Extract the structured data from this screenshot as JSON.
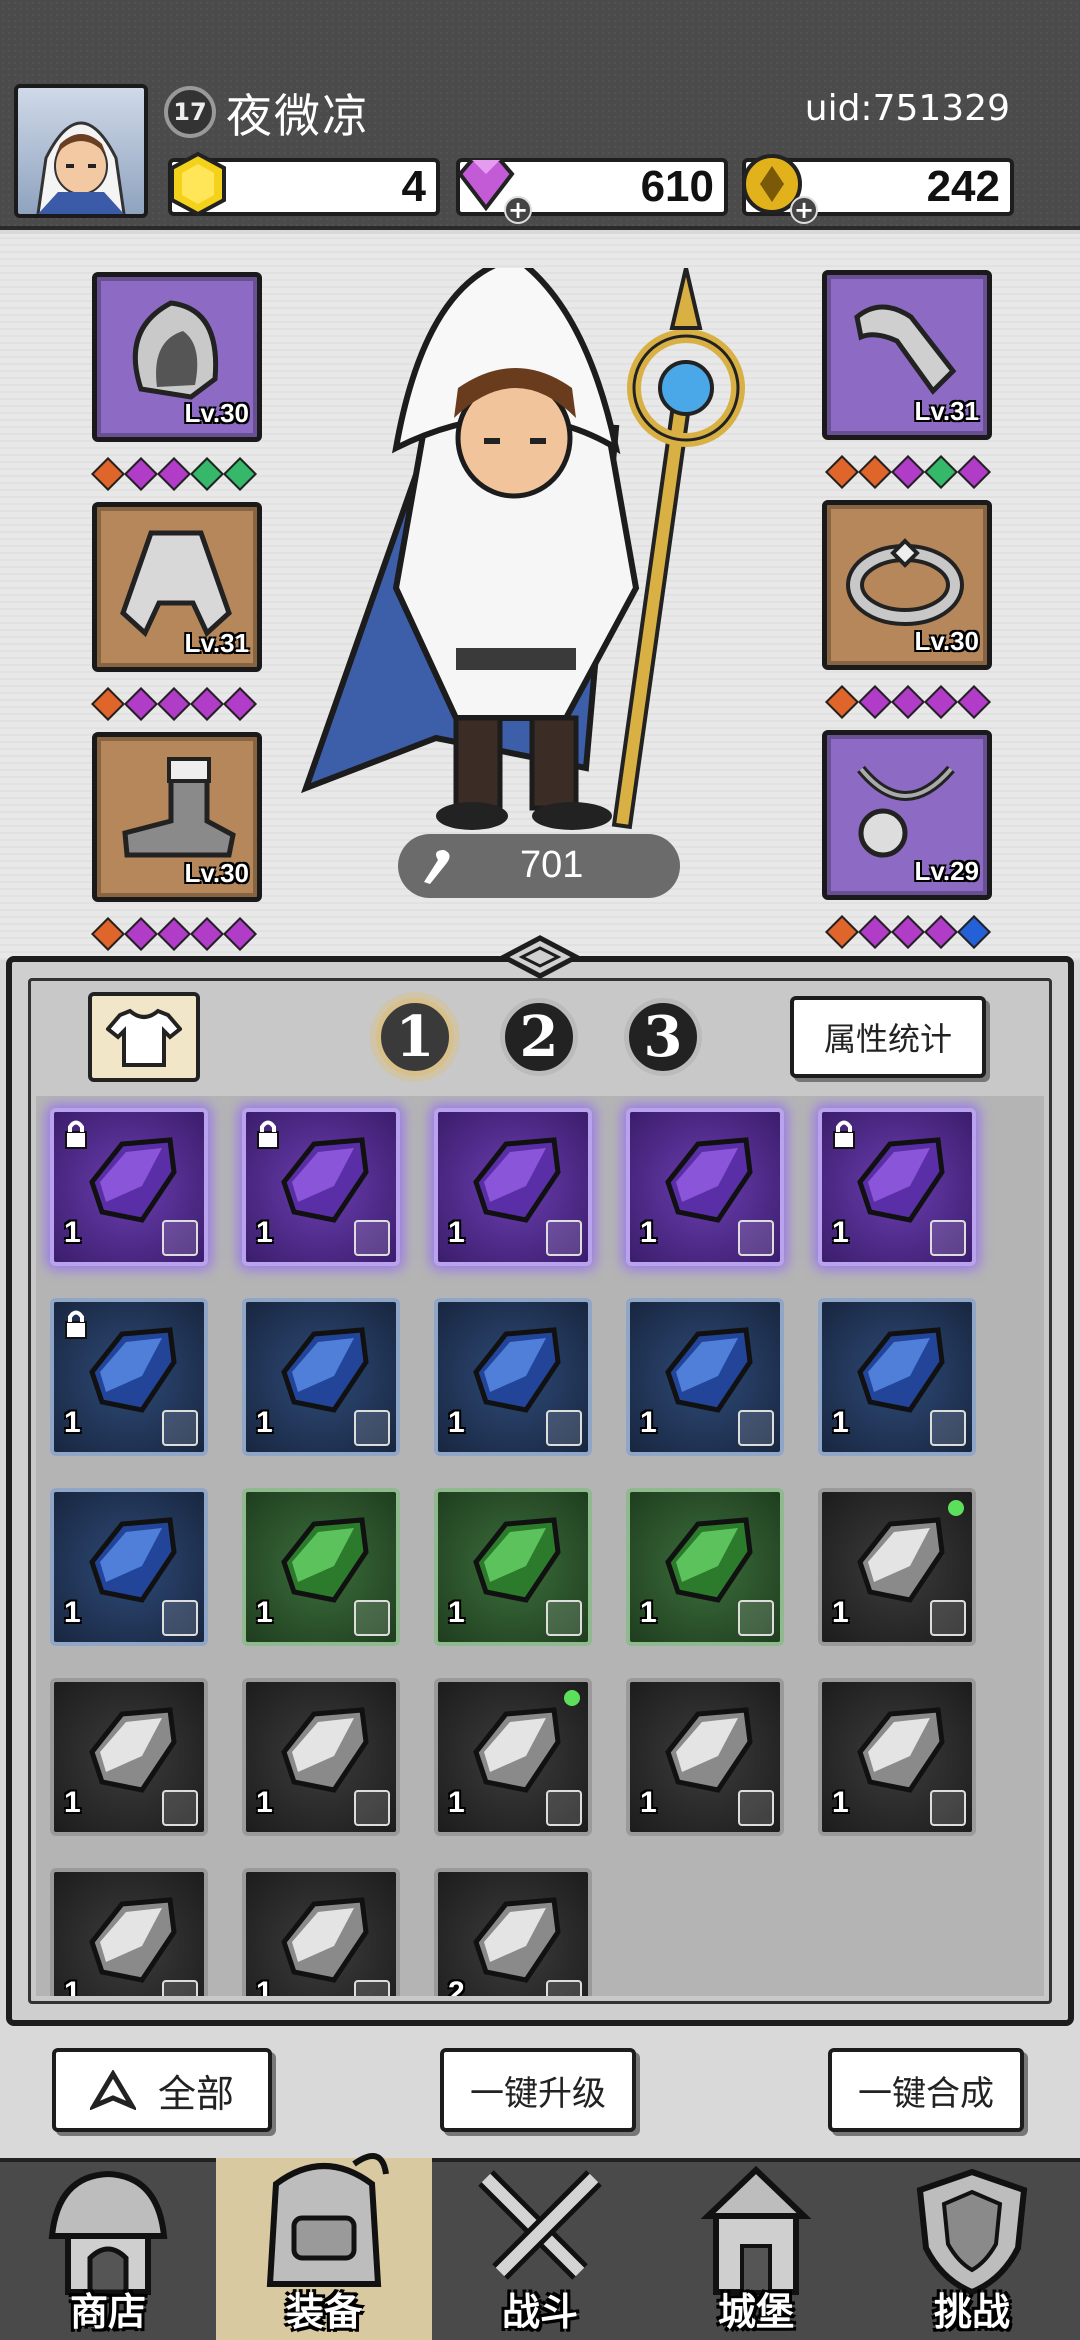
{
  "header": {
    "player_level": "17",
    "player_name": "夜微凉",
    "uid": "uid:751329",
    "resources": [
      {
        "name": "yellow-gem",
        "value": "4"
      },
      {
        "name": "diamond",
        "value": "610"
      },
      {
        "name": "gold-coin",
        "value": "242"
      }
    ]
  },
  "equipment": {
    "left": [
      {
        "name": "hood",
        "level": "Lv.30",
        "rarity": "purple"
      },
      {
        "name": "cloak",
        "level": "Lv.31",
        "rarity": "brown"
      },
      {
        "name": "boots",
        "level": "Lv.30",
        "rarity": "brown"
      }
    ],
    "right": [
      {
        "name": "bracer",
        "level": "Lv.31",
        "rarity": "purple"
      },
      {
        "name": "ring",
        "level": "Lv.30",
        "rarity": "brown"
      },
      {
        "name": "necklace",
        "level": "Lv.29",
        "rarity": "purple"
      }
    ],
    "power": "701"
  },
  "bag": {
    "pages": [
      "1",
      "2",
      "3"
    ],
    "active_page": "1",
    "stats_button": "属性统计",
    "items": [
      {
        "rarity": "purple",
        "count": "1",
        "locked": true,
        "dot": false
      },
      {
        "rarity": "purple",
        "count": "1",
        "locked": true,
        "dot": false
      },
      {
        "rarity": "purple",
        "count": "1",
        "locked": false,
        "dot": false
      },
      {
        "rarity": "purple",
        "count": "1",
        "locked": false,
        "dot": false
      },
      {
        "rarity": "purple",
        "count": "1",
        "locked": true,
        "dot": false
      },
      {
        "rarity": "blue",
        "count": "1",
        "locked": true,
        "dot": false
      },
      {
        "rarity": "blue",
        "count": "1",
        "locked": false,
        "dot": false
      },
      {
        "rarity": "blue",
        "count": "1",
        "locked": false,
        "dot": false
      },
      {
        "rarity": "blue",
        "count": "1",
        "locked": false,
        "dot": false
      },
      {
        "rarity": "blue",
        "count": "1",
        "locked": false,
        "dot": false
      },
      {
        "rarity": "blue",
        "count": "1",
        "locked": false,
        "dot": false
      },
      {
        "rarity": "green",
        "count": "1",
        "locked": false,
        "dot": false
      },
      {
        "rarity": "green",
        "count": "1",
        "locked": false,
        "dot": false
      },
      {
        "rarity": "green",
        "count": "1",
        "locked": false,
        "dot": false
      },
      {
        "rarity": "gray",
        "count": "1",
        "locked": false,
        "dot": true
      },
      {
        "rarity": "gray",
        "count": "1",
        "locked": false,
        "dot": false
      },
      {
        "rarity": "gray",
        "count": "1",
        "locked": false,
        "dot": false
      },
      {
        "rarity": "gray",
        "count": "1",
        "locked": false,
        "dot": true
      },
      {
        "rarity": "gray",
        "count": "1",
        "locked": false,
        "dot": false
      },
      {
        "rarity": "gray",
        "count": "1",
        "locked": false,
        "dot": false
      },
      {
        "rarity": "gray",
        "count": "1",
        "locked": false,
        "dot": false
      },
      {
        "rarity": "gray",
        "count": "1",
        "locked": false,
        "dot": false
      },
      {
        "rarity": "gray",
        "count": "2",
        "locked": false,
        "dot": false
      }
    ]
  },
  "actions": {
    "filter": "全部",
    "upgrade_all": "一键升级",
    "merge_all": "一键合成"
  },
  "nav": [
    {
      "label": "商店"
    },
    {
      "label": "装备"
    },
    {
      "label": "战斗"
    },
    {
      "label": "城堡"
    },
    {
      "label": "挑战"
    }
  ],
  "colors": {
    "purple_slot": "#8d6bc4",
    "brown_slot": "#b5875a",
    "gem_orange": "#e0652a",
    "gem_purple": "#b03cc8",
    "gem_green": "#35b86a",
    "gem_blue": "#2460d8"
  }
}
